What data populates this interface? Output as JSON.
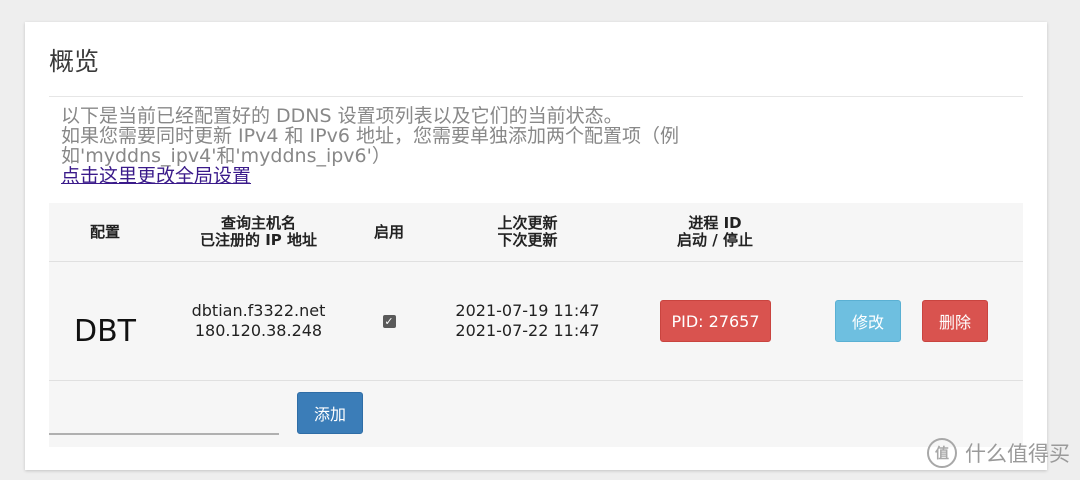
{
  "panel": {
    "title": "概览",
    "description_line1": "以下是当前已经配置好的 DDNS 设置项列表以及它们的当前状态。",
    "description_line2": "如果您需要同时更新 IPv4 和 IPv6 地址，您需要单独添加两个配置项（例如'myddns_ipv4'和'myddns_ipv6'）",
    "global_settings_link": "点击这里更改全局设置"
  },
  "table": {
    "headers": {
      "config": "配置",
      "host_line1": "查询主机名",
      "host_line2": "已注册的 IP 地址",
      "enabled": "启用",
      "update_line1": "上次更新",
      "update_line2": "下次更新",
      "process_line1": "进程 ID",
      "process_line2": "启动 / 停止"
    },
    "rows": [
      {
        "name": "DBT",
        "hostname": "dbtian.f3322.net",
        "ip": "180.120.38.248",
        "enabled": true,
        "last_update": "2021-07-19 11:47",
        "next_update": "2021-07-22 11:47",
        "pid_label": "PID: 27657",
        "edit_label": "修改",
        "delete_label": "删除"
      }
    ],
    "add_input_value": "",
    "add_label": "添加"
  },
  "watermark": {
    "icon_glyph": "值",
    "text": "什么值得买"
  },
  "colors": {
    "danger": "#d9534f",
    "info": "#6ebfe0",
    "primary": "#3b7db8"
  }
}
